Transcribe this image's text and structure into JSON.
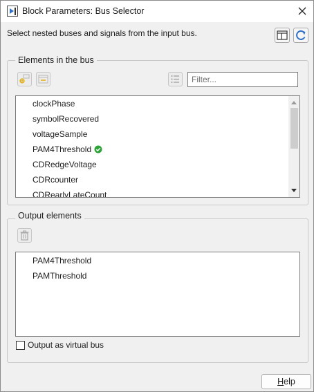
{
  "window": {
    "title": "Block Parameters: Bus Selector",
    "close_glyph": "✕"
  },
  "description": "Select nested buses and signals from the input bus.",
  "toolbar_icons": [
    "layout-toggle-icon",
    "refresh-icon"
  ],
  "elements_group": {
    "label": "Elements in the bus",
    "filter_placeholder": "Filter...",
    "filter_value": "",
    "items": [
      {
        "label": "clockPhase",
        "selected": false
      },
      {
        "label": "symbolRecovered",
        "selected": false
      },
      {
        "label": "voltageSample",
        "selected": false
      },
      {
        "label": "PAM4Threshold",
        "selected": true
      },
      {
        "label": "CDRedgeVoltage",
        "selected": false
      },
      {
        "label": "CDRcounter",
        "selected": false
      },
      {
        "label": "CDRearlyLateCount",
        "selected": false
      }
    ]
  },
  "output_group": {
    "label": "Output elements",
    "items": [
      {
        "label": "PAM4Threshold"
      },
      {
        "label": "PAMThreshold"
      }
    ]
  },
  "virtual_bus": {
    "label": "Output as virtual bus",
    "checked": false
  },
  "help_button": {
    "label_underlined": "H",
    "label_rest": "elp"
  },
  "colors": {
    "check_green": "#2fa33a",
    "accent_blue": "#2f6fc7"
  }
}
